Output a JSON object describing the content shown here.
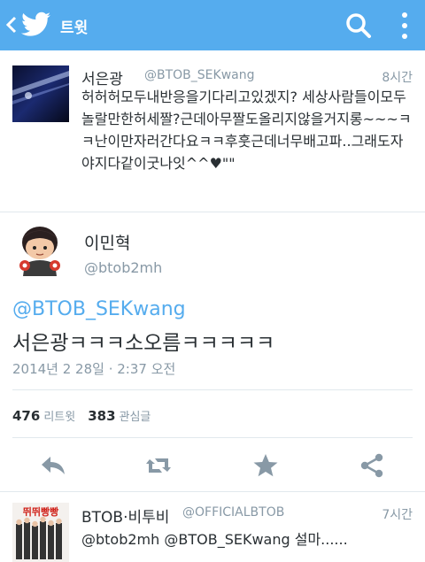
{
  "topbar": {
    "title": "트윗",
    "bg_color": "#55acee"
  },
  "tweet_prev": {
    "name": "서은광",
    "handle": "@BTOB_SEKwang",
    "time": "8시간",
    "text": "허허허모두내반응을기다리고있겠지? 세상사람들이모두놀랄만한허세짤?근데아무짤도올리지않을거지롱~~~ㅋㅋ난이만자러간다요ㅋㅋ후훗근데너무배고파..그래도자야지다같이굿나잇^^♥\"\""
  },
  "tweet_main": {
    "name": "이민혁",
    "handle": "@btob2mh",
    "reply_to": "@BTOB_SEKwang",
    "text": "서은광ㅋㅋㅋ소오름ㅋㅋㅋㅋㅋ",
    "datetime": "2014년 2 28일 · 2:37 오전",
    "retweets": "476",
    "retweets_label": "리트윗",
    "favorites": "383",
    "favorites_label": "관심글"
  },
  "tweet_next": {
    "name": "BTOB·비투비",
    "handle": "@OFFICIALBTOB",
    "time": "7시간",
    "text": "@btob2mh @BTOB_SEKwang 설마......",
    "thumb_title": "뛰뛰빵빵"
  },
  "icons": {
    "back": "chevron-left-icon",
    "logo": "twitter-bird-icon",
    "search": "search-icon",
    "more": "more-vertical-icon",
    "reply": "reply-icon",
    "retweet": "retweet-icon",
    "favorite": "star-icon",
    "share": "share-icon"
  }
}
